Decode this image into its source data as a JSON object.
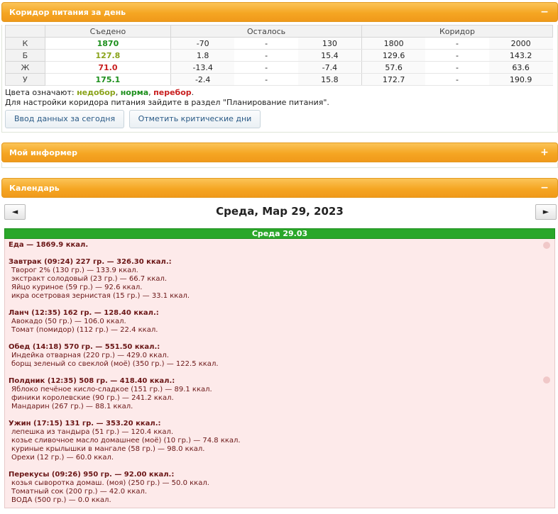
{
  "corridor_panel": {
    "title": "Коридор питания за день",
    "toggle": "−",
    "columns": {
      "eaten": "Съедено",
      "left": "Осталось",
      "corridor": "Коридор"
    },
    "rows": [
      {
        "label": "К",
        "eaten": "1870",
        "eaten_status": "norm",
        "left_from": "-70",
        "left_to": "130",
        "corr_from": "1800",
        "corr_to": "2000"
      },
      {
        "label": "Б",
        "eaten": "127.8",
        "eaten_status": "under",
        "left_from": "1.8",
        "left_to": "15.4",
        "corr_from": "129.6",
        "corr_to": "143.2"
      },
      {
        "label": "Ж",
        "eaten": "71.0",
        "eaten_status": "over",
        "left_from": "-13.4",
        "left_to": "-7.4",
        "corr_from": "57.6",
        "corr_to": "63.6"
      },
      {
        "label": "У",
        "eaten": "175.1",
        "eaten_status": "norm",
        "left_from": "-2.4",
        "left_to": "15.8",
        "corr_from": "172.7",
        "corr_to": "190.9"
      }
    ],
    "dash": "-",
    "legend_prefix": "Цвета означают: ",
    "legend_under": "недобор",
    "legend_norm": "норма",
    "legend_over": "перебор",
    "legend_comma": ", ",
    "legend_end": ".",
    "setup_note": "Для настройки коридора питания зайдите в раздел \"Планирование питания\".",
    "btn_input": "Ввод данных за сегодня",
    "btn_critical": "Отметить критические дни",
    "colors": {
      "under": "#8aa31a",
      "norm": "#1c8f1c",
      "over": "#c81e1e"
    }
  },
  "informer_panel": {
    "title": "Мой информер",
    "toggle": "+"
  },
  "calendar_panel": {
    "title": "Календарь",
    "toggle": "−",
    "prev": "◄",
    "next": "►",
    "date_title": "Среда, Мар 29, 2023",
    "day_header": "Среда 29.03",
    "food_total": "Еда — 1869.9 ккал.",
    "meals": [
      {
        "title": "Завтрак (09:24) 227 гр. — 326.30 ккал.:",
        "items": [
          "Творог 2% (130 гр.) — 133.9 ккал.",
          "экстракт солодовый (23 гр.) — 66.7 ккал.",
          "Яйцо куриное (59 гр.) — 92.6 ккал.",
          "икра осетровая зернистая (15 гр.) — 33.1 ккал."
        ]
      },
      {
        "title": "Ланч (12:35) 162 гр. — 128.40 ккал.:",
        "items": [
          "Авокадо (50 гр.) — 106.0 ккал.",
          "Томат (помидор) (112 гр.) — 22.4 ккал."
        ]
      },
      {
        "title": "Обед (14:18) 570 гр. — 551.50 ккал.:",
        "items": [
          "Индейка отварная (220 гр.) — 429.0 ккал.",
          "борщ зеленый со свеклой (моё) (350 гр.) — 122.5 ккал."
        ]
      },
      {
        "title": "Полдник (12:35) 508 гр. — 418.40 ккал.:",
        "items": [
          "Яблоко печёное кисло-сладкое (151 гр.) — 89.1 ккал.",
          "финики королевские (90 гр.) — 241.2 ккал.",
          "Мандарин (267 гр.) — 88.1 ккал."
        ]
      },
      {
        "title": "Ужин (17:15) 131 гр. — 353.20 ккал.:",
        "items": [
          "лепешка из тандыра (51 гр.) — 120.4 ккал.",
          "козье сливочное масло домашнее (моё) (10 гр.) — 74.8 ккал.",
          "куриные крылышки в мангале (58 гр.) — 98.0 ккал.",
          "Орехи (12 гр.) — 60.0 ккал."
        ]
      },
      {
        "title": "Перекусы (09:26) 950 гр. — 92.00 ккал.:",
        "items": [
          "козья сыворотка домаш. (моя) (250 гр.) — 50.0 ккал.",
          "Томатный сок (200 гр.) — 42.0 ккал.",
          "ВОДА (500 гр.) — 0.0 ккал."
        ]
      }
    ]
  }
}
